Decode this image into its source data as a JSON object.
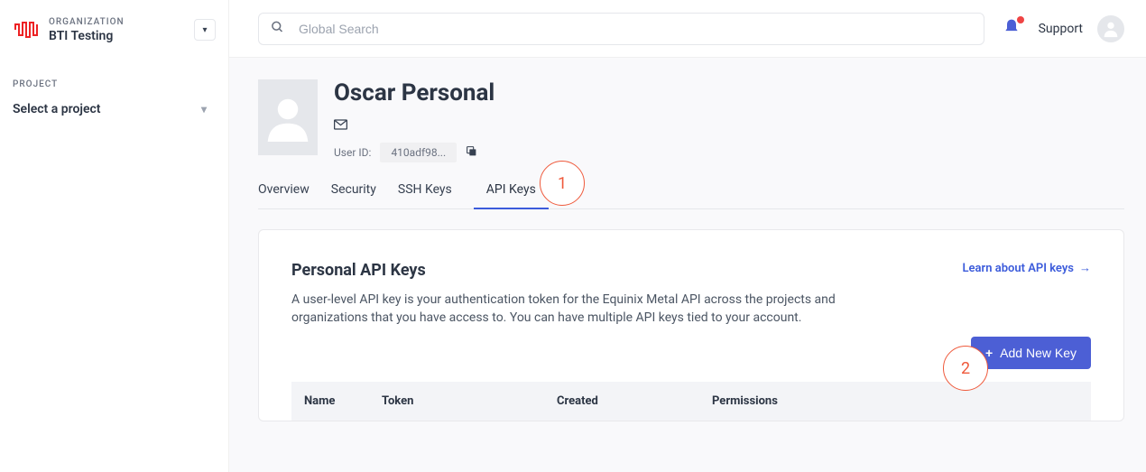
{
  "sidebar": {
    "org_label": "ORGANIZATION",
    "org_name": "BTI Testing",
    "project_label": "PROJECT",
    "project_select": "Select a project"
  },
  "topbar": {
    "search_placeholder": "Global Search",
    "support_label": "Support"
  },
  "user": {
    "name": "Oscar Personal",
    "userid_label": "User ID:",
    "userid_value": "410adf98..."
  },
  "tabs": {
    "overview": "Overview",
    "security": "Security",
    "ssh_keys": "SSH Keys",
    "api_keys": "API Keys"
  },
  "callouts": {
    "one": "1",
    "two": "2"
  },
  "panel": {
    "title": "Personal API Keys",
    "learn_link": "Learn about API keys",
    "description": "A user-level API key is your authentication token for the Equinix Metal API across the projects and organizations that you have access to. You can have multiple API keys tied to your account.",
    "add_key_label": "Add New Key"
  },
  "table": {
    "columns": {
      "name": "Name",
      "token": "Token",
      "created": "Created",
      "permissions": "Permissions"
    }
  }
}
